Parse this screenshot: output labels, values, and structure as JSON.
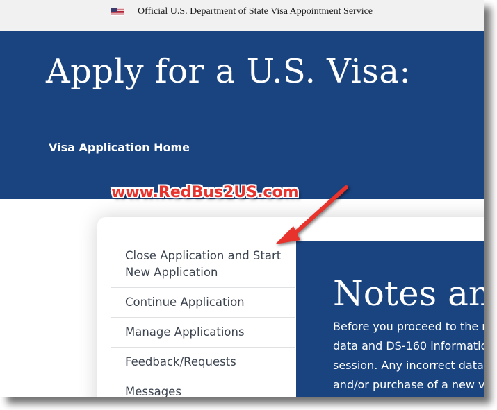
{
  "banner": {
    "flag_icon": "us-flag-icon",
    "text": "Official U.S. Department of State Visa Appointment Service"
  },
  "hero": {
    "title": "Apply for a U.S. Visa:",
    "nav_link": "Visa Application Home"
  },
  "watermark": "www.RedBus2US.com",
  "side_nav": {
    "items": [
      "Close Application and Start New Application",
      "Continue Application",
      "Manage Applications",
      "Feedback/Requests",
      "Messages"
    ]
  },
  "content": {
    "title": "Notes an",
    "lines": [
      "Before you proceed to the n",
      "data and DS-160 information",
      "session. Any incorrect data r",
      "and/or purchase of a new vi"
    ]
  },
  "colors": {
    "primary_blue": "#1a4480",
    "banner_bg": "#f1f1f1",
    "annotation_red": "#e8322c"
  }
}
